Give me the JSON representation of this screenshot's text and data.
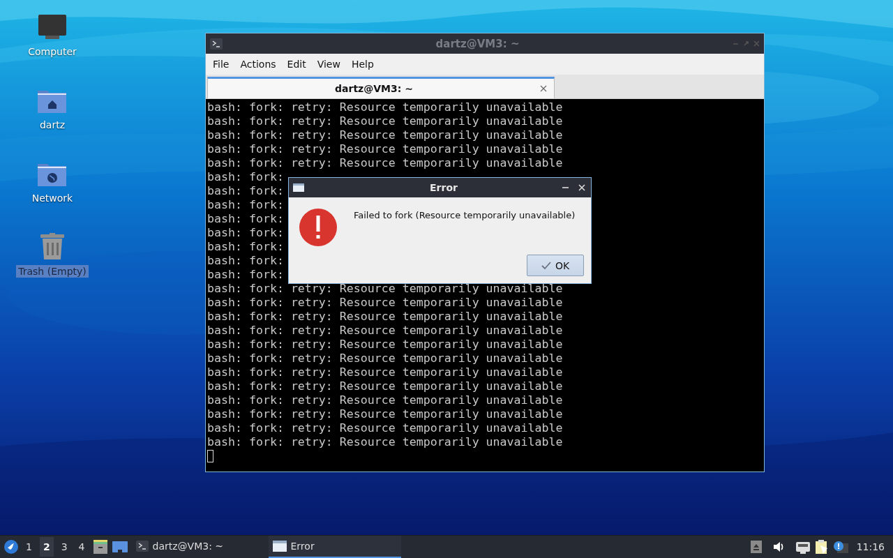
{
  "desktop": {
    "icons": [
      {
        "kind": "computer",
        "label": "Computer",
        "selected": false
      },
      {
        "kind": "home",
        "label": "dartz",
        "selected": false
      },
      {
        "kind": "network",
        "label": "Network",
        "selected": false
      },
      {
        "kind": "trash",
        "label": "Trash (Empty)",
        "selected": true
      }
    ]
  },
  "terminal_window": {
    "title": "dartz@VM3: ~",
    "menu": [
      "File",
      "Actions",
      "Edit",
      "View",
      "Help"
    ],
    "tabs": [
      {
        "label": "dartz@VM3: ~",
        "selected": true
      }
    ],
    "lines": [
      "bash: fork: retry: Resource temporarily unavailable",
      "bash: fork: retry: Resource temporarily unavailable",
      "bash: fork: retry: Resource temporarily unavailable",
      "bash: fork: retry: Resource temporarily unavailable",
      "bash: fork: retry: Resource temporarily unavailable",
      "bash: fork:",
      "bash: fork:",
      "bash: fork:",
      "bash: fork:",
      "bash: fork:",
      "bash: fork:",
      "bash: fork:",
      "bash: fork:",
      "bash: fork: retry: Resource temporarily unavailable",
      "bash: fork: retry: Resource temporarily unavailable",
      "bash: fork: retry: Resource temporarily unavailable",
      "bash: fork: retry: Resource temporarily unavailable",
      "bash: fork: retry: Resource temporarily unavailable",
      "bash: fork: retry: Resource temporarily unavailable",
      "bash: fork: retry: Resource temporarily unavailable",
      "bash: fork: retry: Resource temporarily unavailable",
      "bash: fork: retry: Resource temporarily unavailable",
      "bash: fork: retry: Resource temporarily unavailable",
      "bash: fork: retry: Resource temporarily unavailable",
      "bash: fork: retry: Resource temporarily unavailable"
    ]
  },
  "dialog": {
    "title": "Error",
    "message": "Failed to fork (Resource temporarily unavailable)",
    "buttons": [
      "OK"
    ]
  },
  "taskbar": {
    "workspaces": [
      {
        "label": "1",
        "selected": false
      },
      {
        "label": "2",
        "selected": true
      },
      {
        "label": "3",
        "selected": false
      },
      {
        "label": "4",
        "selected": false
      }
    ],
    "tasks": [
      {
        "kind": "terminal",
        "label": "dartz@VM3: ~",
        "selected": false
      },
      {
        "kind": "window",
        "label": "Error",
        "selected": true
      }
    ],
    "clock": "11:16"
  }
}
